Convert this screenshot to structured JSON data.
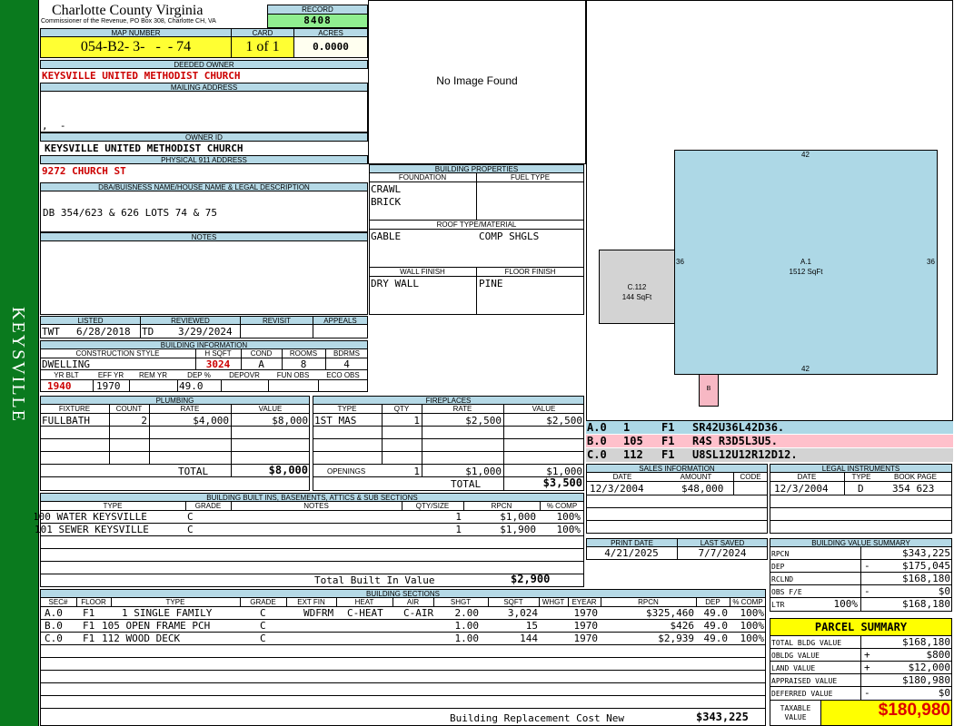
{
  "sidebar": {
    "label": "KEYSVILLE",
    "color": "#0a7a1e"
  },
  "header": {
    "county": "Charlotte County Virginia",
    "office": "Commissioner of the Revenue, PO Box 308, Charlotte CH, VA",
    "record_label": "RECORD",
    "record": "8408"
  },
  "parcel": {
    "map_label": "MAP NUMBER",
    "map": "054-B2- 3-   -  - 74",
    "card_label": "CARD",
    "card": "1 of 1",
    "acres_label": "ACRES",
    "acres": "0.0000"
  },
  "owner": {
    "deeded_label": "DEEDED OWNER",
    "deeded": "KEYSVILLE UNITED METHODIST CHURCH",
    "mailing_label": "MAILING ADDRESS",
    "mailing_line": ",  -",
    "ownerid_label": "OWNER ID",
    "ownerid": "KEYSVILLE UNITED METHODIST CHURCH",
    "physical_label": "PHYSICAL 911 ADDRESS",
    "physical": "9272 CHURCH ST"
  },
  "legal": {
    "label": "DBA/BUISNESS NAME/HOUSE NAME & LEGAL DESCRIPTION",
    "text": "DB 354/623 & 626 LOTS 74 & 75"
  },
  "notes": {
    "label": "NOTES"
  },
  "listing": {
    "listed_label": "LISTED",
    "reviewed_label": "REVIEWED",
    "revisit_label": "REVISIT",
    "appeals_label": "APPEALS",
    "listed_by": "TWT",
    "listed_date": "6/28/2018",
    "reviewed_by": "TD",
    "reviewed_date": "3/29/2024"
  },
  "bldg_info": {
    "label": "BUILDING INFORMATION",
    "style_label": "CONSTRUCTION STYLE",
    "hsqft_label": "H SQFT",
    "cond_label": "COND",
    "rooms_label": "ROOMS",
    "bdrms_label": "BDRMS",
    "style": "DWELLING",
    "hsqft": "3024",
    "cond": "A",
    "rooms": "8",
    "bdrms": "4",
    "yrblt_label": "YR BLT",
    "effyr_label": "EFF YR",
    "remyr_label": "REM YR",
    "dep_label": "DEP %",
    "depovr_label": "DEPOVR",
    "funobs_label": "FUN OBS",
    "ecoobs_label": "ECO OBS",
    "yrblt": "1940",
    "effyr": "1970",
    "dep": "49.0"
  },
  "photo": {
    "text": "No Image Found"
  },
  "bprops": {
    "label": "BUILDING PROPERTIES",
    "foundation_label": "FOUNDATION",
    "fuel_label": "FUEL TYPE",
    "foundation1": "CRAWL",
    "foundation2": "BRICK",
    "roof_label": "ROOF TYPE/MATERIAL",
    "roof1": "GABLE",
    "roof2": "COMP SHGLS",
    "wall_label": "WALL FINISH",
    "floor_label": "FLOOR FINISH",
    "wall": "DRY WALL",
    "floor": "PINE"
  },
  "sketch": {
    "a_label": "A.1",
    "a_area": "1512 SqFt",
    "c_label": "C.112",
    "c_area": "144 SqFt",
    "b_label": "B",
    "dim_top": "42",
    "dim_bottom": "42",
    "dim_left": "36",
    "dim_right": "36",
    "blue": "#add8e6",
    "gray": "#d3d3d3",
    "pink": "#f7b8c4"
  },
  "segments": [
    {
      "code": "A.0",
      "num": "1",
      "floor": "F1",
      "path": "SR42U36L42D36.",
      "color": "#add8e6"
    },
    {
      "code": "B.0",
      "num": "105",
      "floor": "F1",
      "path": "R4S R3D5L3U5.",
      "color": "#ffc0cb"
    },
    {
      "code": "C.0",
      "num": "112",
      "floor": "F1",
      "path": "U8SL12U12R12D12.",
      "color": "#d3d3d3"
    }
  ],
  "plumbing": {
    "label": "PLUMBING",
    "headers": [
      "FIXTURE",
      "COUNT",
      "RATE",
      "VALUE"
    ],
    "rows": [
      {
        "fixture": "FULLBATH",
        "count": "2",
        "rate": "$4,000",
        "value": "$8,000"
      }
    ],
    "total_label": "TOTAL",
    "total": "$8,000"
  },
  "fireplaces": {
    "label": "FIREPLACES",
    "headers": [
      "TYPE",
      "QTY",
      "RATE",
      "VALUE"
    ],
    "rows": [
      {
        "type": "1ST MAS",
        "qty": "1",
        "rate": "$2,500",
        "value": "$2,500"
      }
    ],
    "openings_label": "OPENINGS",
    "openings_qty": "1",
    "openings_rate": "$1,000",
    "openings_value": "$1,000",
    "total_label": "TOTAL",
    "total": "$3,500"
  },
  "sales": {
    "label": "SALES INFORMATION",
    "headers": [
      "DATE",
      "AMOUNT",
      "CODE"
    ],
    "rows": [
      {
        "date": "12/3/2004",
        "amount": "$48,000",
        "code": ""
      }
    ]
  },
  "legal_inst": {
    "label": "LEGAL INSTRUMENTS",
    "headers": [
      "DATE",
      "TYPE",
      "BOOK PAGE"
    ],
    "rows": [
      {
        "date": "12/3/2004",
        "type": "D",
        "book": "354 623"
      }
    ]
  },
  "builtins": {
    "label": "BUILDING BUILT INS, BASEMENTS, ATTICS & SUB SECTIONS",
    "headers": [
      "TYPE",
      "GRADE",
      "NOTES",
      "QTY/SIZE",
      "RPCN",
      "% COMP"
    ],
    "rows": [
      {
        "type": "100 WATER KEYSVILLE",
        "grade": "C",
        "notes": "",
        "qty": "1",
        "rpcn": "$1,000",
        "comp": "100%"
      },
      {
        "type": "101 SEWER KEYSVILLE",
        "grade": "C",
        "notes": "",
        "qty": "1",
        "rpcn": "$1,900",
        "comp": "100%"
      }
    ],
    "total_label": "Total Built In Value",
    "total": "$2,900"
  },
  "dates": {
    "print_label": "PRINT DATE",
    "print": "4/21/2025",
    "saved_label": "LAST SAVED",
    "saved": "7/7/2024"
  },
  "value_summary": {
    "label": "BUILDING VALUE SUMMARY",
    "rows": [
      {
        "label": "RPCN",
        "sign": "",
        "pct": "",
        "value": "$343,225"
      },
      {
        "label": "DEP",
        "sign": "-",
        "pct": "",
        "value": "$175,045"
      },
      {
        "label": "RCLND",
        "sign": "",
        "pct": "",
        "value": "$168,180"
      },
      {
        "label": "OBS F/E",
        "sign": "-",
        "pct": "",
        "value": "$0"
      },
      {
        "label": "LTR",
        "sign": "",
        "pct": "100%",
        "value": "$168,180"
      }
    ]
  },
  "parcel_summary": {
    "label": "PARCEL SUMMARY",
    "rows": [
      {
        "label": "TOTAL BLDG VALUE",
        "sign": "",
        "value": "$168,180"
      },
      {
        "label": "OBLDG VALUE",
        "sign": "+",
        "value": "$800"
      },
      {
        "label": "LAND VALUE",
        "sign": "+",
        "value": "$12,000"
      },
      {
        "label": "APPRAISED VALUE",
        "sign": "",
        "value": "$180,980"
      },
      {
        "label": "DEFERRED VALUE",
        "sign": "-",
        "value": "$0"
      }
    ],
    "taxable_label1": "TAXABLE",
    "taxable_label2": "VALUE",
    "taxable": "$180,980",
    "accent": "#ffff00"
  },
  "sections": {
    "label": "BUILDING SECTIONS",
    "headers": [
      "SEC#",
      "FLOOR",
      "TYPE",
      "GRADE",
      "EXT FIN",
      "HEAT",
      "AIR",
      "SHGT",
      "SQFT",
      "WHGT",
      "EYEAR",
      "RPCN",
      "DEP",
      "% COMP"
    ],
    "rows": [
      {
        "sec": "A.0",
        "floor": "F1",
        "type": "1 SINGLE FAMILY",
        "grade": "C",
        "ext": "WDFRM",
        "heat": "C-HEAT",
        "air": "C-AIR",
        "shgt": "2.00",
        "sqft": "3,024",
        "whgt": "",
        "eyear": "1970",
        "rpcn": "$325,460",
        "dep": "49.0",
        "comp": "100%"
      },
      {
        "sec": "B.0",
        "floor": "F1",
        "type": "105 OPEN FRAME PCH",
        "grade": "C",
        "ext": "",
        "heat": "",
        "air": "",
        "shgt": "1.00",
        "sqft": "15",
        "whgt": "",
        "eyear": "1970",
        "rpcn": "$426",
        "dep": "49.0",
        "comp": "100%"
      },
      {
        "sec": "C.0",
        "floor": "F1",
        "type": "112 WOOD DECK",
        "grade": "C",
        "ext": "",
        "heat": "",
        "air": "",
        "shgt": "1.00",
        "sqft": "144",
        "whgt": "",
        "eyear": "1970",
        "rpcn": "$2,939",
        "dep": "49.0",
        "comp": "100%"
      }
    ],
    "total_label": "Building Replacement Cost New",
    "total": "$343,225"
  }
}
